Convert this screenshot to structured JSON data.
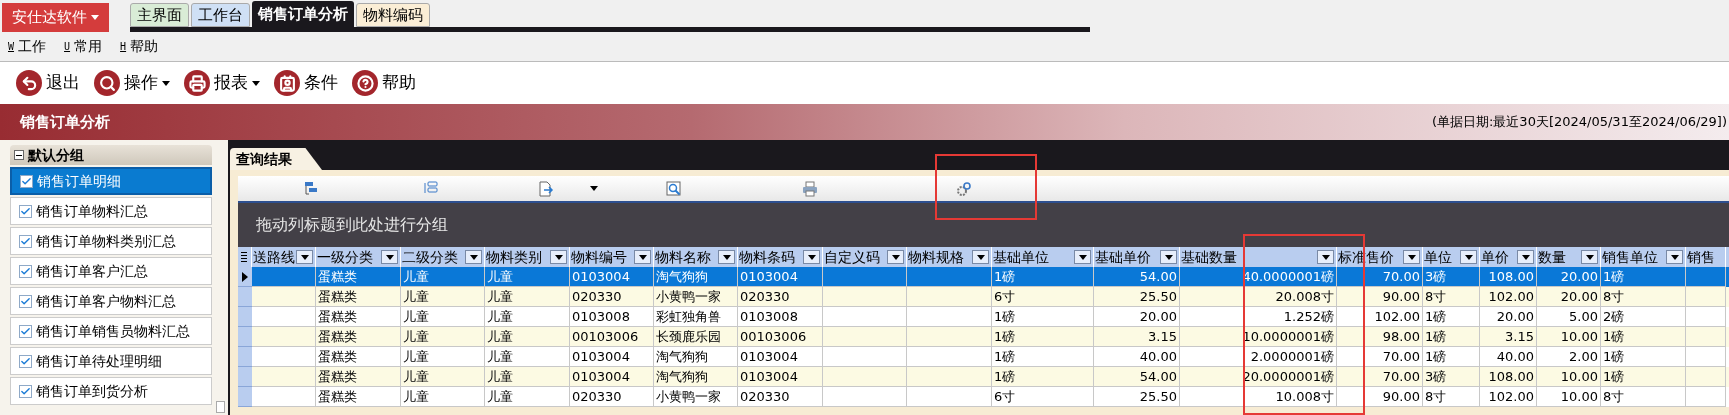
{
  "app_menu": {
    "label": "安仕达软件"
  },
  "tabs": [
    {
      "label": "主界面",
      "selected": false,
      "color": "#d9ecd6"
    },
    {
      "label": "工作台",
      "selected": false,
      "color": "#cfe0f5"
    },
    {
      "label": "销售订单分析",
      "selected": true,
      "color": "#1a181d"
    },
    {
      "label": "物料编码",
      "selected": false,
      "color": "#fbeed6"
    }
  ],
  "menu": [
    {
      "key": "W",
      "label": "工作"
    },
    {
      "key": "U",
      "label": "常用"
    },
    {
      "key": "H",
      "label": "帮助"
    }
  ],
  "toolbar": [
    {
      "kind": "exit",
      "label": "退出",
      "dropdown": false
    },
    {
      "kind": "search",
      "label": "操作",
      "dropdown": true
    },
    {
      "kind": "print",
      "label": "报表",
      "dropdown": true
    },
    {
      "kind": "card",
      "label": "条件",
      "dropdown": false
    },
    {
      "kind": "help",
      "label": "帮助",
      "dropdown": false
    }
  ],
  "banner": {
    "title": "销售订单分析",
    "date_range": "(单据日期:最近30天[2024/05/31至2024/06/29])"
  },
  "sidebar": {
    "group": "默认分组",
    "expanded": true,
    "items": [
      {
        "label": "销售订单明细",
        "checked": true,
        "selected": true
      },
      {
        "label": "销售订单物料汇总",
        "checked": true,
        "selected": false
      },
      {
        "label": "销售订单物料类别汇总",
        "checked": true,
        "selected": false
      },
      {
        "label": "销售订单客户汇总",
        "checked": true,
        "selected": false
      },
      {
        "label": "销售订单客户物料汇总",
        "checked": true,
        "selected": false
      },
      {
        "label": "销售订单销售员物料汇总",
        "checked": true,
        "selected": false
      },
      {
        "label": "销售订单待处理明细",
        "checked": true,
        "selected": false
      },
      {
        "label": "销售订单到货分析",
        "checked": true,
        "selected": false
      }
    ]
  },
  "results": {
    "tab": "查询结果",
    "group_hint": "拖动列标题到此处进行分组",
    "columns": [
      {
        "label": "送路线",
        "filter": true
      },
      {
        "label": "一级分类",
        "numeric": false,
        "filter": true
      },
      {
        "label": "二级分类",
        "numeric": false,
        "filter": true
      },
      {
        "label": "物料类别",
        "numeric": false,
        "filter": true
      },
      {
        "label": "物料编号",
        "numeric": false,
        "filter": true
      },
      {
        "label": "物料名称",
        "numeric": false,
        "filter": true
      },
      {
        "label": "物料条码",
        "numeric": false,
        "filter": true
      },
      {
        "label": "自定义码",
        "filter": true
      },
      {
        "label": "物料规格",
        "filter": true
      },
      {
        "label": "基础单位",
        "numeric": false,
        "filter": true
      },
      {
        "label": "基础单价",
        "numeric": true,
        "filter": true
      },
      {
        "label": "基础数量",
        "numeric": true,
        "filter": true
      },
      {
        "label": "标准售价",
        "numeric": true,
        "filter": true
      },
      {
        "label": "单位",
        "numeric": false,
        "filter": true
      },
      {
        "label": "单价",
        "numeric": true,
        "filter": true
      },
      {
        "label": "数量",
        "numeric": true,
        "filter": true
      },
      {
        "label": "销售单位",
        "numeric": false,
        "filter": true
      },
      {
        "label": "销售",
        "filter": false
      }
    ],
    "rows": [
      {
        "selected": true,
        "cells": [
          null,
          "蛋糕类",
          "儿童",
          "儿童",
          "0103004",
          "淘气狗狗",
          "0103004",
          null,
          null,
          "1磅",
          "54.00",
          "40.0000001磅",
          "70.00",
          "3磅",
          "108.00",
          "20.00",
          "1磅",
          null
        ]
      },
      {
        "selected": false,
        "cells": [
          null,
          "蛋糕类",
          "儿童",
          "儿童",
          "020330",
          "小黄鸭一家",
          "020330",
          null,
          null,
          "6寸",
          "25.50",
          "20.008寸",
          "90.00",
          "8寸",
          "102.00",
          "20.00",
          "8寸",
          null
        ]
      },
      {
        "selected": false,
        "cells": [
          null,
          "蛋糕类",
          "儿童",
          "儿童",
          "0103008",
          "彩虹独角兽",
          "0103008",
          null,
          null,
          "1磅",
          "20.00",
          "1.252磅",
          "102.00",
          "1磅",
          "20.00",
          "5.00",
          "2磅",
          null
        ]
      },
      {
        "selected": false,
        "cells": [
          null,
          "蛋糕类",
          "儿童",
          "儿童",
          "00103006",
          "长颈鹿乐园",
          "00103006",
          null,
          null,
          "1磅",
          "3.15",
          "10.0000001磅",
          "98.00",
          "1磅",
          "3.15",
          "10.00",
          "1磅",
          null
        ]
      },
      {
        "selected": false,
        "cells": [
          null,
          "蛋糕类",
          "儿童",
          "儿童",
          "0103004",
          "淘气狗狗",
          "0103004",
          null,
          null,
          "1磅",
          "40.00",
          "2.0000001磅",
          "70.00",
          "1磅",
          "40.00",
          "2.00",
          "1磅",
          null
        ]
      },
      {
        "selected": false,
        "cells": [
          null,
          "蛋糕类",
          "儿童",
          "儿童",
          "0103004",
          "淘气狗狗",
          "0103004",
          null,
          null,
          "1磅",
          "54.00",
          "20.0000001磅",
          "70.00",
          "3磅",
          "108.00",
          "10.00",
          "1磅",
          null
        ]
      },
      {
        "selected": false,
        "cells": [
          null,
          "蛋糕类",
          "儿童",
          "儿童",
          "020330",
          "小黄鸭一家",
          "020330",
          null,
          null,
          "6寸",
          "25.50",
          "10.008寸",
          "90.00",
          "8寸",
          "102.00",
          "10.00",
          "8寸",
          null
        ]
      }
    ]
  }
}
